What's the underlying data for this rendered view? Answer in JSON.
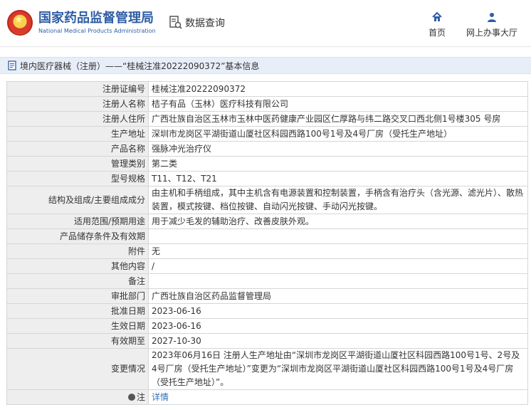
{
  "header": {
    "logo_cn": "国家药品监督管理局",
    "logo_en": "National Medical Products Administration",
    "query_label": "数据查询",
    "home_label": "首页",
    "service_label": "网上办事大厅"
  },
  "breadcrumb": {
    "text": "境内医疗器械（注册）——“桂械注准20222090372”基本信息"
  },
  "detail": {
    "rows": [
      {
        "label": "注册证编号",
        "value": "桂械注准20222090372"
      },
      {
        "label": "注册人名称",
        "value": "桔子有品（玉林）医疗科技有限公司"
      },
      {
        "label": "注册人住所",
        "value": "广西壮族自治区玉林市玉林中医药健康产业园区仁厚路与纬二路交叉口西北侧1号楼305 号房"
      },
      {
        "label": "生产地址",
        "value": "深圳市龙岗区平湖街道山厦社区科园西路100号1号及4号厂房（受托生产地址）"
      },
      {
        "label": "产品名称",
        "value": "强脉冲光治疗仪"
      },
      {
        "label": "管理类别",
        "value": "第二类"
      },
      {
        "label": "型号规格",
        "value": "T11、T12、T21"
      },
      {
        "label": "结构及组成/主要组成成分",
        "value": "由主机和手柄组成，其中主机含有电源装置和控制装置，手柄含有治疗头（含光源、滤光片）、散热装置，模式按键、档位按键、自动闪光按键、手动闪光按键。"
      },
      {
        "label": "适用范围/预期用途",
        "value": "用于减少毛发的辅助治疗、改善皮肤外观。"
      },
      {
        "label": "产品储存条件及有效期",
        "value": ""
      },
      {
        "label": "附件",
        "value": "无"
      },
      {
        "label": "其他内容",
        "value": "/"
      },
      {
        "label": "备注",
        "value": ""
      },
      {
        "label": "审批部门",
        "value": "广西壮族自治区药品监督管理局"
      },
      {
        "label": "批准日期",
        "value": "2023-06-16"
      },
      {
        "label": "生效日期",
        "value": "2023-06-16"
      },
      {
        "label": "有效期至",
        "value": "2027-10-30"
      },
      {
        "label": "变更情况",
        "value": "2023年06月16日 注册人生产地址由“深圳市龙岗区平湖街道山厦社区科园西路100号1号、2号及4号厂房（受托生产地址）”变更为“深圳市龙岗区平湖街道山厦社区科园西路100号1号及4号厂房（受托生产地址）”。"
      },
      {
        "label": "注",
        "value": "详情"
      }
    ]
  },
  "colors": {
    "brand_blue": "#2f5ea6",
    "link_blue": "#2f6fbd",
    "label_bg": "#eeeeee",
    "crumb_bg": "#e8eef8"
  },
  "icons": {
    "logo": "national-emblem-icon",
    "query": "document-search-icon",
    "home": "home-icon",
    "service": "user-icon",
    "crumb": "document-icon",
    "note": "pin-icon"
  }
}
